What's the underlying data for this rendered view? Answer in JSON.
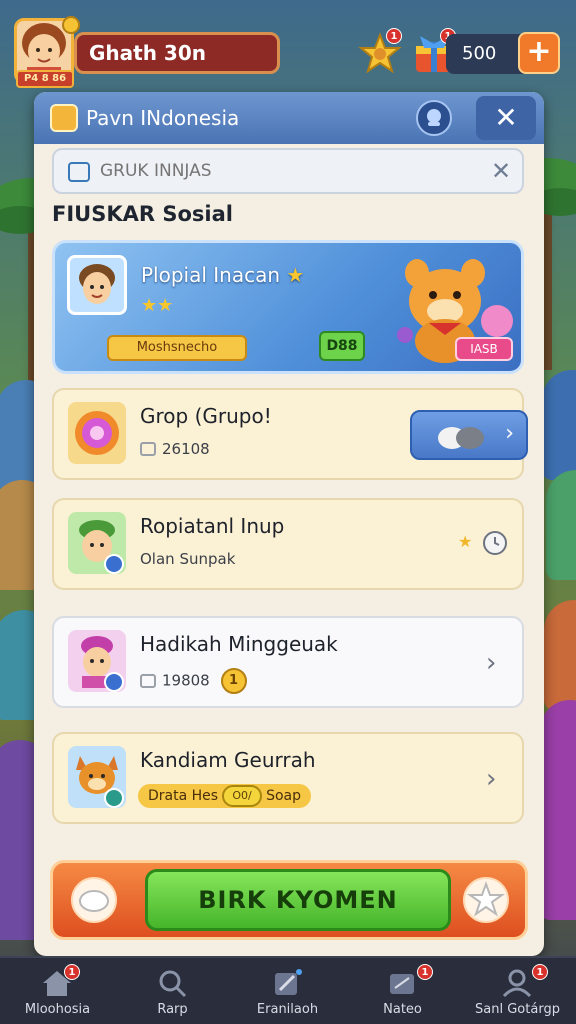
{
  "hud": {
    "player_name": "Ghath 30n",
    "player_badge": "P4 8 86",
    "notif_quest": "1",
    "notif_gift": "1",
    "currency_value": "500",
    "plus_label": "+"
  },
  "panel": {
    "title": "Pavn INdonesia",
    "close_label": "✕",
    "search_placeholder": "GRUK INNJAS",
    "search_clear": "✕",
    "section_title": "FIUSKAR Sosial"
  },
  "featured": {
    "title": "Plopial Inacan",
    "title_star": "★",
    "stars": "★★",
    "tag": "Moshsnecho",
    "count": "D88",
    "mascot_label": "IASB"
  },
  "cards": [
    {
      "title": "Grop (Grupo!",
      "sub": "26108"
    },
    {
      "title": "Ropiatanl Inup",
      "sub": "Olan Sunpak",
      "star": "★"
    },
    {
      "title": "Hadikah Minggeuak",
      "sub": "19808"
    },
    {
      "title": "Kandiam Geurrah",
      "sub_a": "Drata Hes",
      "sub_b": "Soap",
      "coin": "O0/"
    }
  ],
  "action": {
    "label": "BIRK KYOMEN"
  },
  "nav": [
    {
      "label": "Mloohosia",
      "badge": "1"
    },
    {
      "label": "Rarp"
    },
    {
      "label": "Eranilaoh"
    },
    {
      "label": "Nateo",
      "badge": "1"
    },
    {
      "label": "Sanl Gotárgp",
      "badge": "1"
    }
  ],
  "colors": {
    "header_blue": "#4a73b4",
    "accent_orange": "#f07a2a",
    "action_green": "#45b52a",
    "card_cream": "#fbf1d4"
  }
}
